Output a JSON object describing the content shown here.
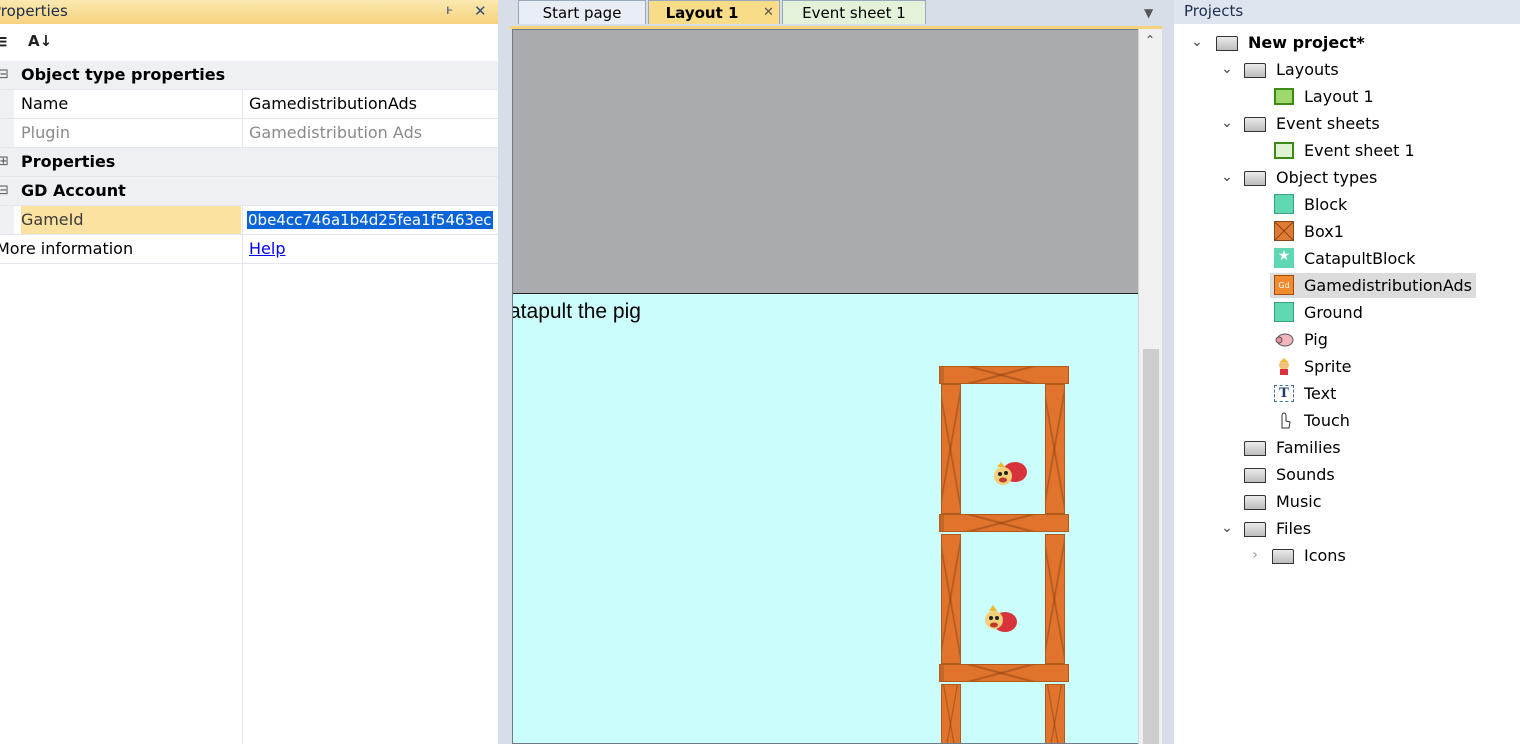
{
  "properties_panel": {
    "title": "Properties",
    "pin_glyph": "ͱ",
    "close_glyph": "✕",
    "rows": [
      {
        "type": "category",
        "expander": "⊟",
        "label": "Object type properties"
      },
      {
        "type": "prop",
        "name": "Name",
        "value": "GamedistributionAds"
      },
      {
        "type": "prop",
        "name": "Plugin",
        "value": "Gamedistribution Ads",
        "readonly": true
      },
      {
        "type": "category",
        "expander": "⊞",
        "label": "Properties"
      },
      {
        "type": "category",
        "expander": "⊟",
        "label": "GD Account"
      },
      {
        "type": "prop",
        "name": "GameId",
        "value": "0be4cc746a1b4d25fea1f5463ec",
        "selected": true
      },
      {
        "type": "prop",
        "name": "More information",
        "value": "Help",
        "link": true
      }
    ]
  },
  "tabs": {
    "start_page": "Start page",
    "layout_1": "Layout 1",
    "layout_close": "✕",
    "event_sheet_1": "Event sheet 1",
    "menu_arrow": "▼"
  },
  "layout_view": {
    "text_object": "atapult the pig",
    "scroll_up": "⌃"
  },
  "projects_panel": {
    "title": "Projects",
    "tree": {
      "root": "New project*",
      "layouts": "Layouts",
      "layout_1": "Layout 1",
      "event_sheets": "Event sheets",
      "event_sheet_1": "Event sheet 1",
      "object_types": "Object types",
      "objects": {
        "block": "Block",
        "box1": "Box1",
        "catapult_block": "CatapultBlock",
        "gamedistribution_ads": "GamedistributionAds",
        "ground": "Ground",
        "pig": "Pig",
        "sprite": "Sprite",
        "text": "Text",
        "touch": "Touch"
      },
      "families": "Families",
      "sounds": "Sounds",
      "music": "Music",
      "files": "Files",
      "icons": "Icons"
    },
    "gd_icon_label": "Gd",
    "text_icon_label": "T",
    "star_icon_glyph": "★"
  },
  "colors": {
    "accent": "#f6d27e",
    "selection": "#0a64d8",
    "layout_bg": "#cbfdfd",
    "canvas_bg": "#a9abae",
    "box_orange": "#e0742c"
  }
}
